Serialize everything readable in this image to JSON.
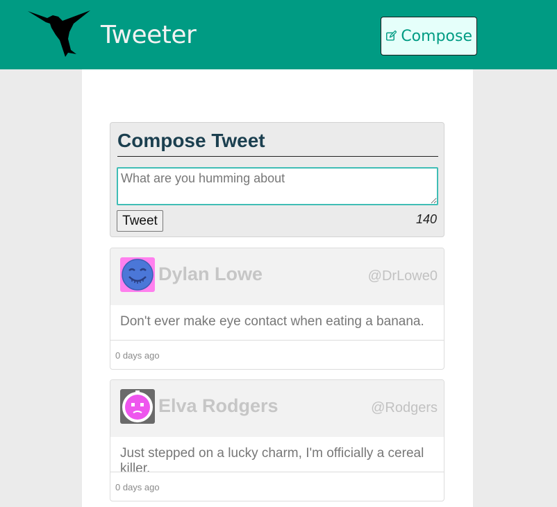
{
  "nav": {
    "brand": "Tweeter",
    "compose_label": "Compose",
    "bg_color": "#009b83"
  },
  "composer": {
    "title": "Compose Tweet",
    "placeholder": "What are you humming about",
    "value": "",
    "submit_label": "Tweet",
    "counter": "140"
  },
  "tweets": [
    {
      "name": "Dylan Lowe",
      "handle": "@DrLowe0",
      "text": "Don't ever make eye contact when eating a banana.",
      "time": "0 days ago",
      "avatar_icon": "smiling-blue-face-icon"
    },
    {
      "name": "Elva Rodgers",
      "handle": "@Rodgers",
      "text": "Just stepped on a lucky charm, I'm officially a cereal killer.",
      "time": "0 days ago",
      "avatar_icon": "pink-face-icon"
    }
  ]
}
